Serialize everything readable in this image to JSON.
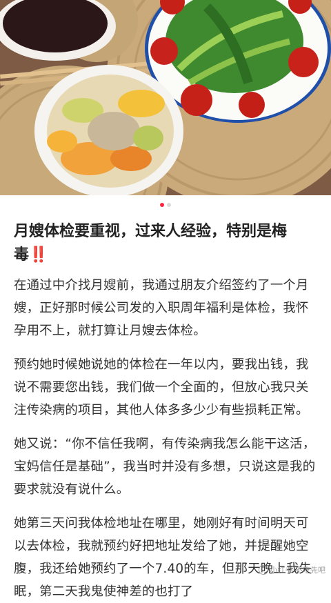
{
  "post": {
    "title": "月嫂体检要重视，过来人经验，特别是梅毒",
    "title_mark": "‼️",
    "paragraphs": [
      "在通过中介找月嫂前，我通过朋友介绍签约了一个月嫂，正好那时候公司发的入职周年福利是体检，我怀孕用不上，就打算让月嫂去体检。",
      "预约她时候她说她的体检在一年以内，要我出钱，我说不需要您出钱，我们做一个全面的，但放心我只关注传染病的项目，其他人体多多少少有些损耗正常。",
      "她又说：“你不信任我啊，有传染病我怎么能干这活，宝妈信任是基础”，我当时并没有多想，只说这是我的要求就没有说什么。",
      "她第三天问我体检地址在哪里，她刚好有时间明天可以去体检，我就预约好把地址发给了她，并提醒她空腹，我还给她预约了一个7.40的车，但那天晚上我失眠，第二天我鬼使神差的也打了"
    ]
  },
  "carousel": {
    "total": 2,
    "active_index": 0
  },
  "colors": {
    "accent": "#ff2442",
    "mark": "#e8262f"
  },
  "watermark": {
    "text": "小红书 不吃先吧"
  }
}
